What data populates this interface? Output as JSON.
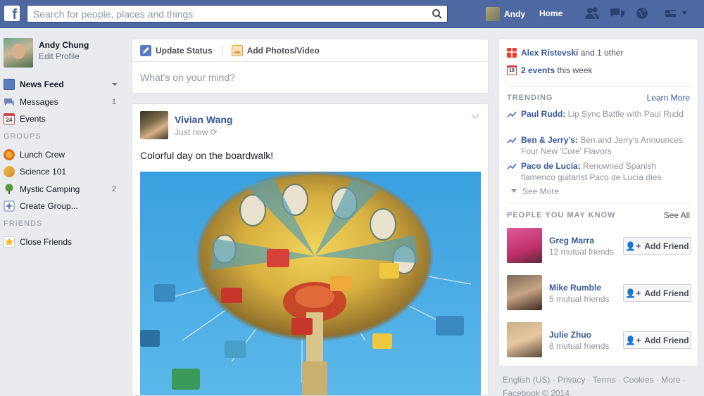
{
  "topbar": {
    "logo": "f",
    "search_placeholder": "Search for people, places and things",
    "user_name": "Andy",
    "home_label": "Home",
    "icons": [
      "friends-icon",
      "messages-icon",
      "globe-icon",
      "privacy-icon"
    ]
  },
  "sidebar": {
    "profile_name": "Andy Chung",
    "profile_edit": "Edit Profile",
    "items": [
      {
        "label": "News Feed",
        "icon": "news-feed-icon",
        "count": ""
      },
      {
        "label": "Messages",
        "icon": "messages-icon",
        "count": "1"
      },
      {
        "label": "Events",
        "icon": "events-icon",
        "count": ""
      }
    ],
    "groups_header": "GROUPS",
    "groups": [
      {
        "label": "Lunch Crew",
        "icon": "group-icon",
        "count": ""
      },
      {
        "label": "Science 101",
        "icon": "group-icon",
        "count": ""
      },
      {
        "label": "Mystic Camping",
        "icon": "tree-icon",
        "count": "2"
      },
      {
        "label": "Create Group...",
        "icon": "plus-icon",
        "count": ""
      }
    ],
    "friends_header": "FRIENDS",
    "friends": [
      {
        "label": "Close Friends",
        "icon": "star-icon",
        "count": ""
      }
    ],
    "events_badge": "24"
  },
  "composer": {
    "update_status": "Update Status",
    "add_media": "Add Photos/Video",
    "placeholder": "What's on your mind?"
  },
  "post": {
    "author": "Vivian Wang",
    "time": "Just now",
    "text": "Colorful day on the boardwalk!"
  },
  "right": {
    "birthday_name": "Alex Ristevski",
    "birthday_rest": "and 1 other",
    "events_count": "2 events",
    "events_rest": "this week",
    "calendar_day": "18",
    "trending_header": "TRENDING",
    "learn_more": "Learn More",
    "trending": [
      {
        "title": "Paul Rudd:",
        "desc": "Lip Sync Battle with Paul Rudd"
      },
      {
        "title": "Ben & Jerry's:",
        "desc": "Ben and Jerry's Announces Four New 'Core' Flavors"
      },
      {
        "title": "Paco de Lucía:",
        "desc": "Renowned Spanish flamenco guitarist Paco de Lucía dies"
      }
    ],
    "see_more": "See More",
    "pymk_header": "PEOPLE YOU MAY KNOW",
    "see_all": "See All",
    "people": [
      {
        "name": "Greg Marra",
        "mutual": "12 mutual friends",
        "button": "Add Friend",
        "avatar_color": "#d94f8a"
      },
      {
        "name": "Mike Rumble",
        "mutual": "5 mutual friends",
        "button": "Add Friend",
        "avatar_color": "#6d5a4a"
      },
      {
        "name": "Julie Zhuo",
        "mutual": "8 mutual friends",
        "button": "Add Friend",
        "avatar_color": "#b79a7a"
      }
    ]
  },
  "footer": {
    "line1": "English (US) · Privacy · Terms · Cookies · More ·",
    "line2": "Facebook © 2014"
  },
  "colors": {
    "topbar": "#4e69a2",
    "link": "#365899",
    "background": "#e9ebee"
  }
}
